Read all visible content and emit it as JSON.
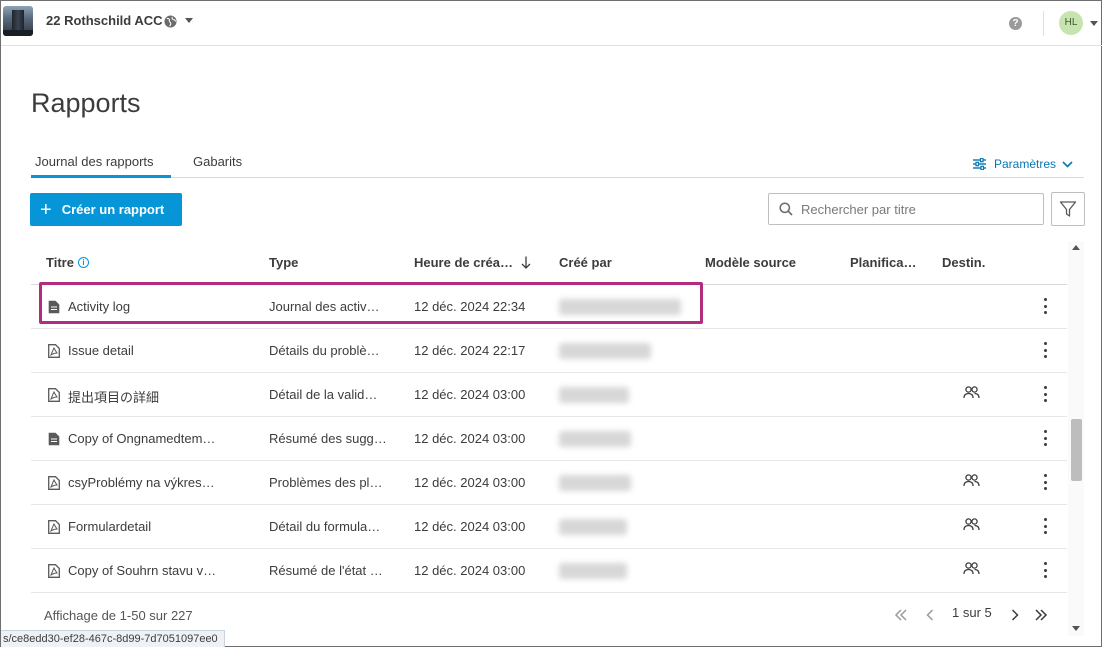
{
  "header": {
    "project_name": "22 Rothschild ACC",
    "help_symbol": "?",
    "user_initials": "HL"
  },
  "page": {
    "title": "Rapports",
    "tabs": [
      {
        "label": "Journal des rapports",
        "active": true
      },
      {
        "label": "Gabarits",
        "active": false
      }
    ],
    "settings_label": "Paramètres",
    "create_button_label": "Créer un rapport",
    "search_placeholder": "Rechercher par titre"
  },
  "table": {
    "columns": {
      "title": "Titre",
      "type": "Type",
      "created_time": "Heure de créa…",
      "created_by": "Créé par",
      "source_model": "Modèle source",
      "schedule": "Planifica…",
      "destination": "Destin."
    },
    "sort_direction": "descending",
    "rows": [
      {
        "icon": "document-icon",
        "title": "Activity log",
        "type": "Journal des activ…",
        "time": "12 déc. 2024 22:34",
        "created_by_redacted": true,
        "shared": false,
        "highlighted": true
      },
      {
        "icon": "pdf-document-icon",
        "title": "Issue detail",
        "type": "Détails du problè…",
        "time": "12 déc. 2024 22:17",
        "created_by_redacted": true,
        "shared": false,
        "highlighted": false
      },
      {
        "icon": "pdf-document-icon",
        "title": "提出項目の詳細",
        "type": "Détail de la valid…",
        "time": "12 déc. 2024 03:00",
        "created_by_redacted": true,
        "shared": true,
        "highlighted": false
      },
      {
        "icon": "document-icon",
        "title": "Copy of Ongnamedtem…",
        "type": "Résumé des sugg…",
        "time": "12 déc. 2024 03:00",
        "created_by_redacted": true,
        "shared": false,
        "highlighted": false
      },
      {
        "icon": "pdf-document-icon",
        "title": "csyProblémy na výkres…",
        "type": "Problèmes des pl…",
        "time": "12 déc. 2024 03:00",
        "created_by_redacted": true,
        "shared": true,
        "highlighted": false
      },
      {
        "icon": "pdf-document-icon",
        "title": "Formulardetail",
        "type": "Détail du formula…",
        "time": "12 déc. 2024 03:00",
        "created_by_redacted": true,
        "shared": true,
        "highlighted": false
      },
      {
        "icon": "pdf-document-icon",
        "title": "Copy of Souhrn stavu v…",
        "type": "Résumé de l'état …",
        "time": "12 déc. 2024 03:00",
        "created_by_redacted": true,
        "shared": true,
        "highlighted": false
      }
    ]
  },
  "footer": {
    "count_text": "Affichage de 1-50 sur 227",
    "page_text": "1 sur 5"
  },
  "status_bar": {
    "url": "s/ce8edd30-ef28-467c-8d99-7d7051097ee0"
  },
  "colors": {
    "accent": "#0696d7",
    "highlight_border": "#b22d7f",
    "avatar_bg": "#c7e3b0"
  }
}
